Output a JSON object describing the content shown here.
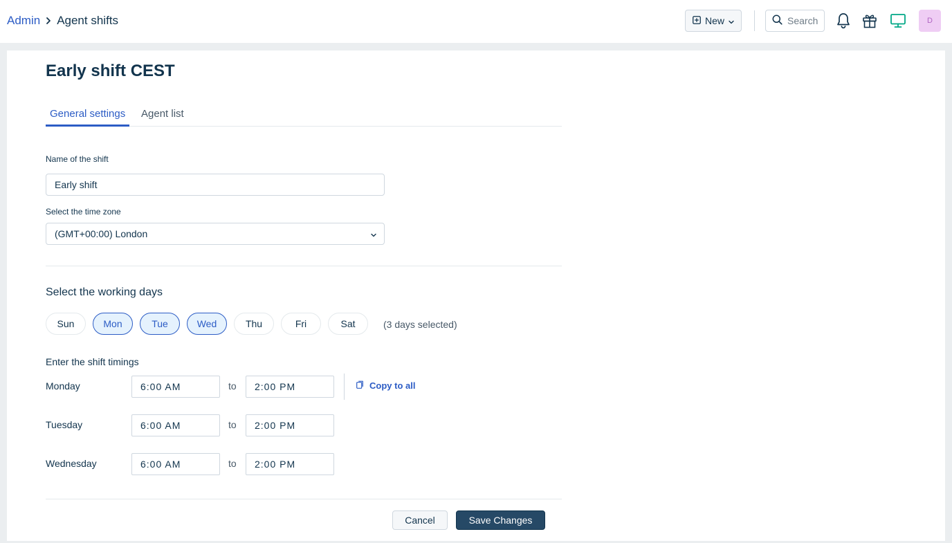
{
  "breadcrumb": {
    "parent": "Admin",
    "current": "Agent shifts"
  },
  "topbar": {
    "new_label": "New",
    "search_placeholder": "Search",
    "avatar_initial": "D",
    "accent_monitor_color": "#00a886",
    "avatar_bg": "#efcdf4"
  },
  "page": {
    "title": "Early shift CEST"
  },
  "tabs": [
    {
      "label": "General settings",
      "active": true
    },
    {
      "label": "Agent list",
      "active": false
    }
  ],
  "form": {
    "name_label": "Name of the shift",
    "name_value": "Early shift",
    "tz_label": "Select the time zone",
    "tz_value": "(GMT+00:00) London"
  },
  "working_days": {
    "title": "Select the working days",
    "days": [
      {
        "label": "Sun",
        "selected": false
      },
      {
        "label": "Mon",
        "selected": true
      },
      {
        "label": "Tue",
        "selected": true
      },
      {
        "label": "Wed",
        "selected": true
      },
      {
        "label": "Thu",
        "selected": false
      },
      {
        "label": "Fri",
        "selected": false
      },
      {
        "label": "Sat",
        "selected": false
      }
    ],
    "count_text": "(3 days selected)"
  },
  "timings": {
    "title": "Enter the shift timings",
    "to_label": "to",
    "copy_label": "Copy to all",
    "rows": [
      {
        "day": "Monday",
        "from": "6:00 AM",
        "to": "2:00 PM"
      },
      {
        "day": "Tuesday",
        "from": "6:00 AM",
        "to": "2:00 PM"
      },
      {
        "day": "Wednesday",
        "from": "6:00 AM",
        "to": "2:00 PM"
      }
    ]
  },
  "actions": {
    "cancel": "Cancel",
    "save": "Save Changes"
  }
}
